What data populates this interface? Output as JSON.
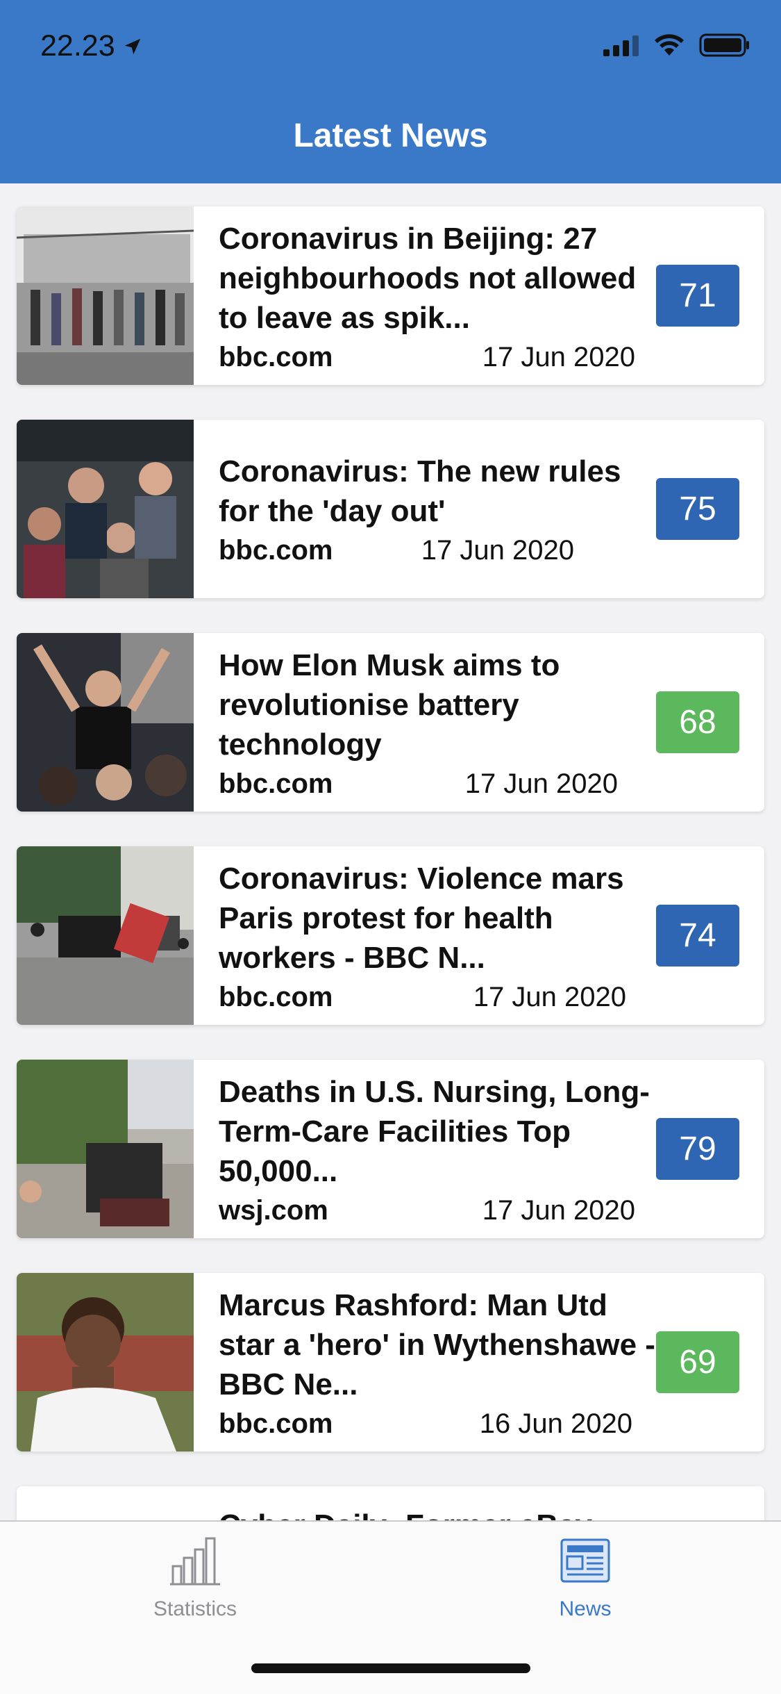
{
  "status_bar": {
    "time": "22.23"
  },
  "header": {
    "title": "Latest News"
  },
  "colors": {
    "header_bg": "#3a78c8",
    "score_blue": "#2f66b3",
    "score_green": "#5cb85c",
    "tab_active": "#3a78c8",
    "tab_inactive": "#8e8e93"
  },
  "articles": [
    {
      "headline": "Coronavirus in Beijing: 27 neighbourhoods not allowed to leave as spik...",
      "source": "bbc.com",
      "date": "17 Jun 2020",
      "score": "71",
      "score_color": "blue"
    },
    {
      "headline": "Coronavirus: The new rules for the 'day out'",
      "source": "bbc.com",
      "date": "17 Jun 2020",
      "score": "75",
      "score_color": "blue"
    },
    {
      "headline": "How Elon Musk aims to revolutionise battery technology",
      "source": "bbc.com",
      "date": "17 Jun 2020",
      "score": "68",
      "score_color": "green"
    },
    {
      "headline": "Coronavirus: Violence mars Paris protest for health workers - BBC N...",
      "source": "bbc.com",
      "date": "17 Jun 2020",
      "score": "74",
      "score_color": "blue"
    },
    {
      "headline": "Deaths in U.S. Nursing, Long-Term-Care Facilities Top 50,000...",
      "source": "wsj.com",
      "date": "17 Jun 2020",
      "score": "79",
      "score_color": "blue"
    },
    {
      "headline": "Marcus Rashford: Man Utd star a 'hero' in Wythenshawe - BBC Ne...",
      "source": "bbc.com",
      "date": "16 Jun 2020",
      "score": "69",
      "score_color": "green"
    },
    {
      "headline": "Cyber Daily: Former eBay",
      "source": "",
      "date": "",
      "score": "",
      "score_color": "blue"
    }
  ],
  "tabbar": {
    "tabs": [
      {
        "label": "Statistics",
        "icon": "bar-chart-icon",
        "active": false
      },
      {
        "label": "News",
        "icon": "newspaper-icon",
        "active": true
      }
    ]
  }
}
